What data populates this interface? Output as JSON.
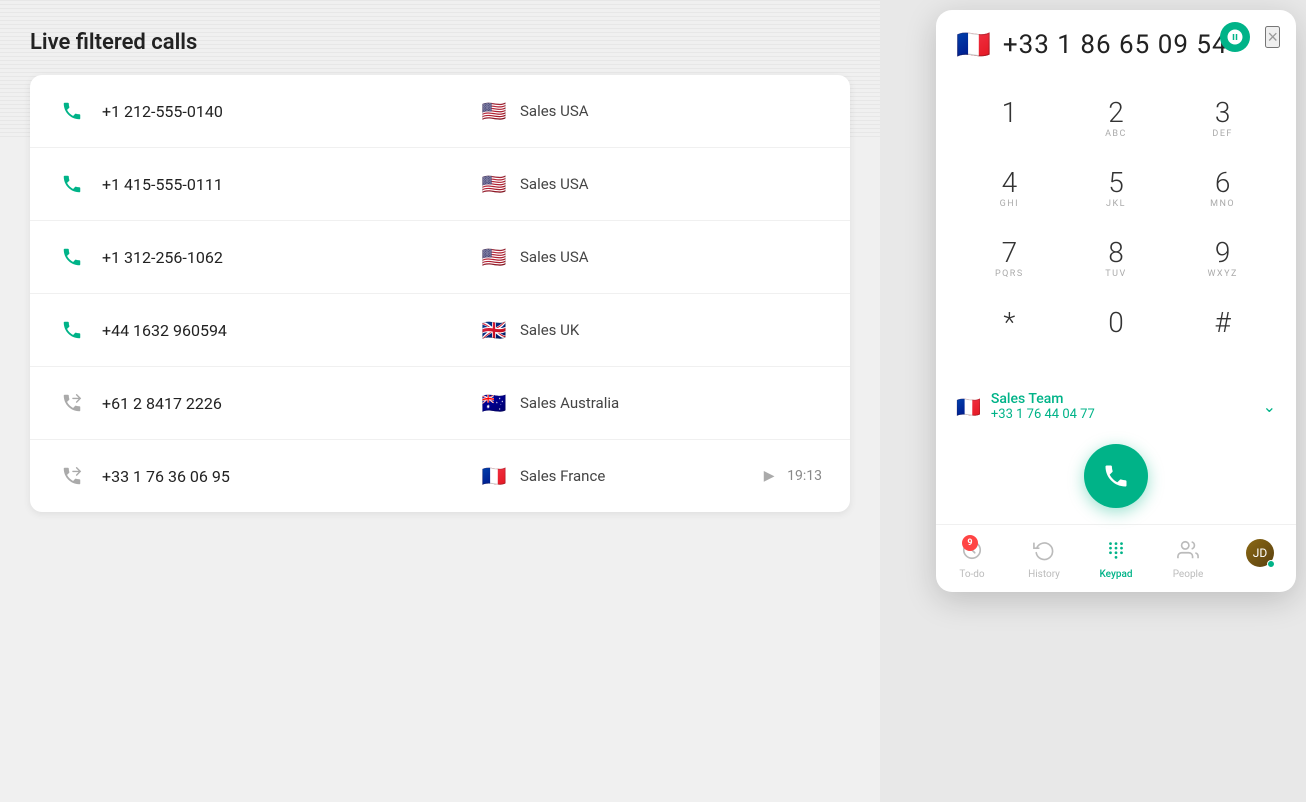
{
  "panel": {
    "title": "Live filtered calls",
    "calls": [
      {
        "number": "+1 212-555-0140",
        "team": "Sales USA",
        "country": "us",
        "type": "inbound",
        "duration": null
      },
      {
        "number": "+1 415-555-0111",
        "team": "Sales USA",
        "country": "us",
        "type": "inbound",
        "duration": null
      },
      {
        "number": "+1 312-256-1062",
        "team": "Sales USA",
        "country": "us",
        "type": "inbound",
        "duration": null
      },
      {
        "number": "+44 1632 960594",
        "team": "Sales UK",
        "country": "gb",
        "type": "inbound",
        "duration": null
      },
      {
        "number": "+61 2 8417 2226",
        "team": "Sales Australia",
        "country": "au",
        "type": "outbound",
        "duration": null
      },
      {
        "number": "+33 1 76 36 06 95",
        "team": "Sales France",
        "country": "fr",
        "type": "outbound",
        "duration": "19:13"
      }
    ]
  },
  "widget": {
    "phone_number": "+33 1 86 65 09 54",
    "close_label": "×",
    "dialpad": [
      {
        "num": "1",
        "letters": ""
      },
      {
        "num": "2",
        "letters": "ABC"
      },
      {
        "num": "3",
        "letters": "DEF"
      },
      {
        "num": "4",
        "letters": "GHI"
      },
      {
        "num": "5",
        "letters": "JKL"
      },
      {
        "num": "6",
        "letters": "MNO"
      },
      {
        "num": "7",
        "letters": "PQRS"
      },
      {
        "num": "8",
        "letters": "TUV"
      },
      {
        "num": "9",
        "letters": "WXYZ"
      },
      {
        "num": "*",
        "letters": ""
      },
      {
        "num": "0",
        "letters": ""
      },
      {
        "num": "#",
        "letters": ""
      }
    ],
    "caller_id": {
      "name": "Sales Team",
      "number": "+33 1 76 44 04 77"
    },
    "nav": [
      {
        "label": "To-do",
        "icon": "todo",
        "badge": "9",
        "active": false
      },
      {
        "label": "History",
        "icon": "history",
        "badge": null,
        "active": false
      },
      {
        "label": "Keypad",
        "icon": "keypad",
        "badge": null,
        "active": true
      },
      {
        "label": "People",
        "icon": "people",
        "badge": null,
        "active": false
      },
      {
        "label": "avatar",
        "icon": "avatar",
        "badge": null,
        "active": false
      }
    ]
  }
}
